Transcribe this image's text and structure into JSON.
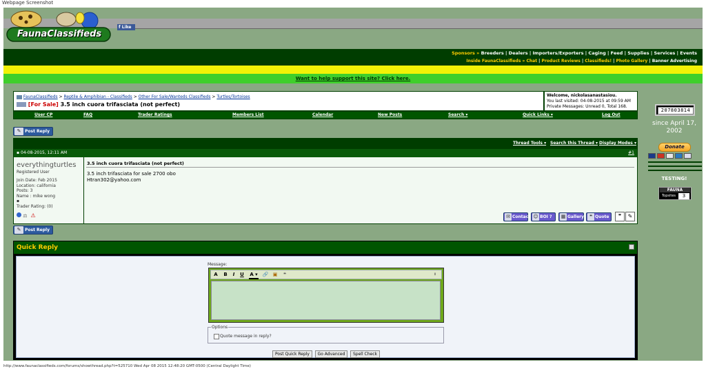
{
  "window": {
    "title": "Webpage Screenshot"
  },
  "header": {
    "site_name": "FaunaClassifieds",
    "fb_like": "Like"
  },
  "navbar": {
    "sponsors_label": "Sponsors »",
    "sponsor_links": [
      "Breeders",
      "Dealers",
      "Importers/Exporters",
      "Caging",
      "Feed",
      "Supplies",
      "Services",
      "Events"
    ],
    "inside_label": "Inside FaunaClassifieds » Chat",
    "inside_links": [
      "Product Reviews",
      "Classifieds!",
      "Photo Gallery"
    ],
    "banner_link": "Banner Advertising"
  },
  "support_link": "Want to help support this site? Click here.",
  "breadcrumb": {
    "items": [
      "FaunaClassifieds",
      "Reptile & Amphibian - Classifieds",
      "Other For Sale/Wanteds Classifieds",
      "Turtles/Tortoises"
    ],
    "prefix": "[For Sale]",
    "thread_title": "3.5 inch cuora trifasciata (not perfect)"
  },
  "welcome": {
    "greeting": "Welcome, nickolasanastasiou.",
    "last_visited": "You last visited: 04-08-2015 at 09:59 AM",
    "pm": "Private Messages: Unread 0, Total 168."
  },
  "tabs": [
    "User CP",
    "FAQ",
    "Trader Ratings",
    "Members List",
    "Calendar",
    "New Posts",
    "Search ▾",
    "Quick Links ▾",
    "Log Out"
  ],
  "post_reply_label": "Post Reply",
  "thread_tools": {
    "tools": "Thread Tools ▾",
    "search": "Search this Thread ▾",
    "display": "Display Modes ▾"
  },
  "post": {
    "date": "04-08-2015, 12:11 AM",
    "number": "#1",
    "username": "everythingturtles",
    "user_title": "Registered User",
    "join_date": "Join Date: Feb 2015",
    "location": "Location: california",
    "posts": "Posts: 3",
    "name": "Name : mike wong",
    "trader_rating": "Trader Rating: (0)",
    "title": "3.5 inch cuora trifasciata (not perfect)",
    "body_line1": "3.5 inch trifasciata for sale 2700 obo",
    "body_line2": "Htran302@yahoo.com",
    "actions": [
      "Contact",
      "BOI ?",
      "Gallery",
      "Quote"
    ]
  },
  "quick_reply": {
    "title": "Quick Reply",
    "message_label": "Message:",
    "options_legend": "Options",
    "quote_checkbox": "Quote message in reply?",
    "buttons": [
      "Post Quick Reply",
      "Go Advanced",
      "Spell Check"
    ]
  },
  "sidebar": {
    "counter": "207803814",
    "since": "since April 17, 2002",
    "donate": "Donate",
    "testing": "TESTING!",
    "topsites_title": "FAUNA",
    "topsites_sub": "Topsites",
    "topsites_rank": "3"
  },
  "status_bar": "http://www.faunaclassifieds.com/forums/showthread.php?t=525710 Wed Apr 08 2015 12:48:20 GMT-0500 (Central Daylight Time)",
  "colors": {
    "frame": "#8aa883",
    "dark_green": "#003d00",
    "accent_green": "#3fcf2b",
    "yellow": "#f2f206",
    "prefix_red": "#cc0000"
  }
}
